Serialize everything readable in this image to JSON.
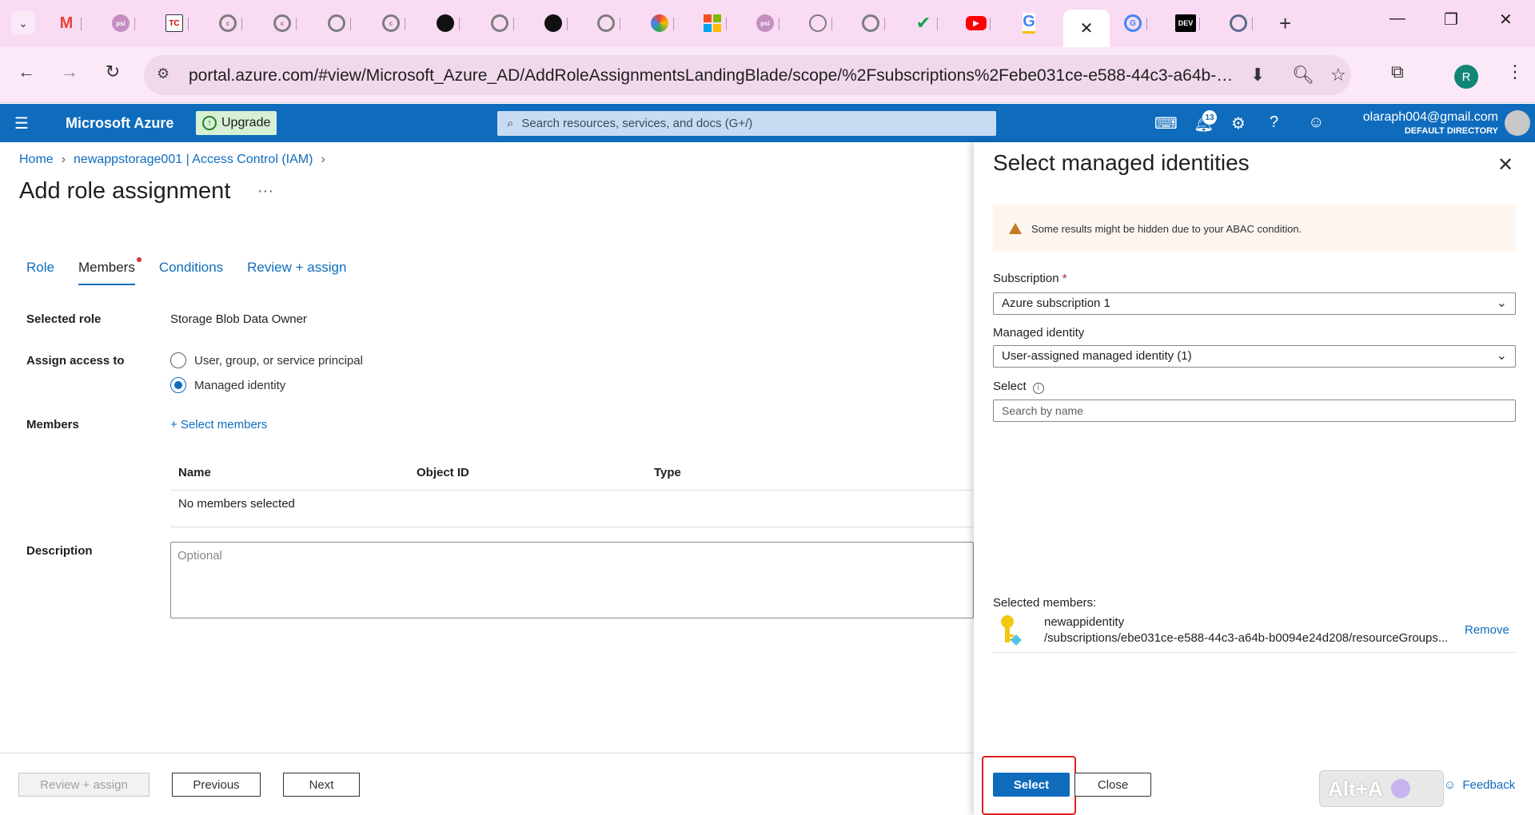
{
  "browser": {
    "tabs": [
      {
        "icon": "chevron-down",
        "label": "⌄"
      },
      {
        "icon": "gmail-icon",
        "label": "M",
        "color": "#ea4335"
      },
      {
        "icon": "psi-icon",
        "label": "psi"
      },
      {
        "icon": "tc-icon",
        "label": "TC"
      },
      {
        "icon": "c-icon",
        "label": "c"
      },
      {
        "icon": "c-icon",
        "label": "c"
      },
      {
        "icon": "chatgpt-icon",
        "label": ""
      },
      {
        "icon": "c-icon",
        "label": "c"
      },
      {
        "icon": "github-icon",
        "label": ""
      },
      {
        "icon": "chatgpt-icon",
        "label": ""
      },
      {
        "icon": "github-icon",
        "label": ""
      },
      {
        "icon": "chatgpt-icon",
        "label": ""
      },
      {
        "icon": "colorwheel-icon",
        "label": ""
      },
      {
        "icon": "microsoft-icon",
        "label": ""
      },
      {
        "icon": "psi-icon",
        "label": "psi"
      },
      {
        "icon": "ring-icon",
        "label": ""
      },
      {
        "icon": "chatgpt-icon",
        "label": ""
      },
      {
        "icon": "check-icon",
        "label": "✔"
      },
      {
        "icon": "youtube-icon",
        "label": "▶"
      },
      {
        "icon": "google-icon",
        "label": "G"
      },
      {
        "icon": "close-icon",
        "label": "✕"
      },
      {
        "icon": "google-icon",
        "label": "G"
      },
      {
        "icon": "dev-icon",
        "label": "DEV"
      },
      {
        "icon": "globe-icon",
        "label": ""
      }
    ],
    "new_tab": "+",
    "url": "portal.azure.com/#view/Microsoft_Azure_AD/AddRoleAssignmentsLandingBlade/scope/%2Fsubscriptions%2Febe031ce-e588-44c3-a64b-b00...",
    "profile_initial": "R",
    "win_min": "—",
    "win_restore": "❐",
    "win_close": "✕"
  },
  "azure": {
    "brand": "Microsoft Azure",
    "upgrade": "Upgrade",
    "search_placeholder": "Search resources, services, and docs (G+/)",
    "notification_count": "13",
    "user_email": "olaraph004@gmail.com",
    "user_directory": "DEFAULT DIRECTORY"
  },
  "main": {
    "breadcrumb": [
      "Home",
      "newappstorage001 | Access Control (IAM)"
    ],
    "title": "Add role assignment",
    "more": "···",
    "tabs": [
      {
        "label": "Role"
      },
      {
        "label": "Members",
        "active": true
      },
      {
        "label": "Conditions"
      },
      {
        "label": "Review + assign"
      }
    ],
    "selected_role_label": "Selected role",
    "selected_role_value": "Storage Blob Data Owner",
    "assign_access_label": "Assign access to",
    "assign_options": [
      "User, group, or service principal",
      "Managed identity"
    ],
    "members_label": "Members",
    "select_members": "+ Select members",
    "table_headers": [
      "Name",
      "Object ID",
      "Type"
    ],
    "table_empty": "No members selected",
    "description_label": "Description",
    "description_placeholder": "Optional",
    "footer": {
      "review_assign": "Review + assign",
      "previous": "Previous",
      "next": "Next"
    }
  },
  "panel": {
    "title": "Select managed identities",
    "warning": "Some results might be hidden due to your ABAC condition.",
    "subscription_label": "Subscription",
    "subscription_required": "*",
    "subscription_value": "Azure subscription 1",
    "managed_identity_label": "Managed identity",
    "managed_identity_value": "User-assigned managed identity (1)",
    "select_label": "Select",
    "search_placeholder": "Search by name",
    "selected_members_label": "Selected members:",
    "member_name": "newappidentity",
    "member_path": "/subscriptions/ebe031ce-e588-44c3-a64b-b0094e24d208/resourceGroups...",
    "remove": "Remove",
    "select_button": "Select",
    "close_button": "Close",
    "alt_a": "Alt+A",
    "feedback": "Feedback"
  }
}
